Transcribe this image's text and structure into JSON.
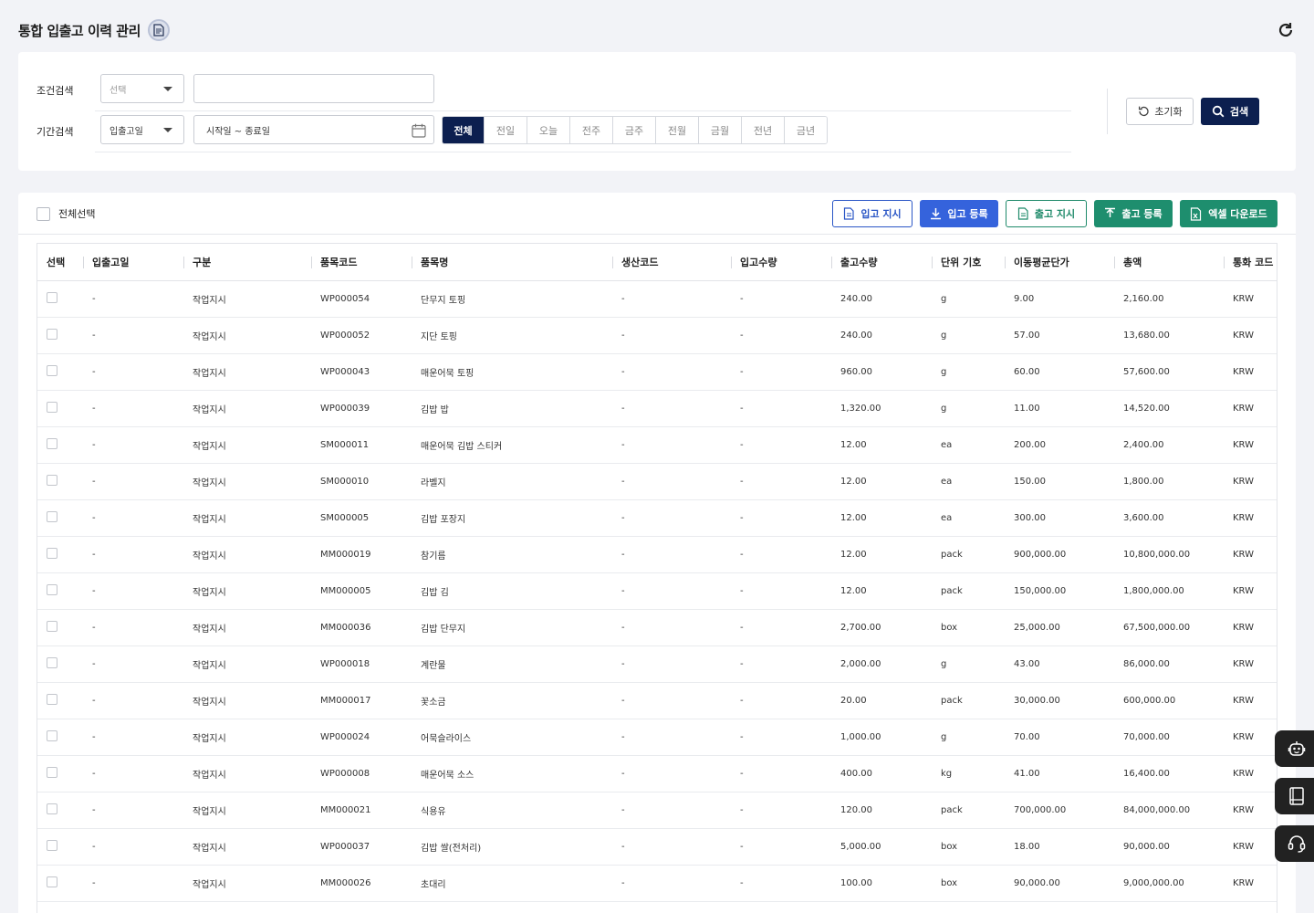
{
  "header": {
    "title": "통합 입출고 이력 관리"
  },
  "search": {
    "condition_label": "조건검색",
    "condition_select": "선택",
    "condition_input": "",
    "period_label": "기간검색",
    "period_select": "입출고일",
    "date_range": "시작일 ~ 종료일",
    "periods": [
      "전체",
      "전일",
      "오늘",
      "전주",
      "금주",
      "전월",
      "금월",
      "전년",
      "금년"
    ],
    "active_period": "전체",
    "reset_label": "초기화",
    "search_label": "검색"
  },
  "toolbar": {
    "select_all": "전체선택",
    "btn_in_order": "입고 지시",
    "btn_in_register": "입고 등록",
    "btn_out_order": "출고 지시",
    "btn_out_register": "출고 등록",
    "btn_excel": "엑셀 다운로드"
  },
  "table": {
    "columns": [
      "선택",
      "입출고일",
      "구분",
      "품목코드",
      "품목명",
      "생산코드",
      "입고수량",
      "출고수량",
      "단위 기호",
      "이동평균단가",
      "총액",
      "통화 코드"
    ],
    "rows": [
      [
        "-",
        "작업지시",
        "WP000054",
        "단무지 토핑",
        "-",
        "-",
        "240.00",
        "g",
        "9.00",
        "2,160.00",
        "KRW"
      ],
      [
        "-",
        "작업지시",
        "WP000052",
        "지단 토핑",
        "-",
        "-",
        "240.00",
        "g",
        "57.00",
        "13,680.00",
        "KRW"
      ],
      [
        "-",
        "작업지시",
        "WP000043",
        "매운어묵 토핑",
        "-",
        "-",
        "960.00",
        "g",
        "60.00",
        "57,600.00",
        "KRW"
      ],
      [
        "-",
        "작업지시",
        "WP000039",
        "김밥 밥",
        "-",
        "-",
        "1,320.00",
        "g",
        "11.00",
        "14,520.00",
        "KRW"
      ],
      [
        "-",
        "작업지시",
        "SM000011",
        "매운어묵 김밥 스티커",
        "-",
        "-",
        "12.00",
        "ea",
        "200.00",
        "2,400.00",
        "KRW"
      ],
      [
        "-",
        "작업지시",
        "SM000010",
        "라벨지",
        "-",
        "-",
        "12.00",
        "ea",
        "150.00",
        "1,800.00",
        "KRW"
      ],
      [
        "-",
        "작업지시",
        "SM000005",
        "김밥 포장지",
        "-",
        "-",
        "12.00",
        "ea",
        "300.00",
        "3,600.00",
        "KRW"
      ],
      [
        "-",
        "작업지시",
        "MM000019",
        "참기름",
        "-",
        "-",
        "12.00",
        "pack",
        "900,000.00",
        "10,800,000.00",
        "KRW"
      ],
      [
        "-",
        "작업지시",
        "MM000005",
        "김밥 김",
        "-",
        "-",
        "12.00",
        "pack",
        "150,000.00",
        "1,800,000.00",
        "KRW"
      ],
      [
        "-",
        "작업지시",
        "MM000036",
        "김밥 단무지",
        "-",
        "-",
        "2,700.00",
        "box",
        "25,000.00",
        "67,500,000.00",
        "KRW"
      ],
      [
        "-",
        "작업지시",
        "WP000018",
        "계란물",
        "-",
        "-",
        "2,000.00",
        "g",
        "43.00",
        "86,000.00",
        "KRW"
      ],
      [
        "-",
        "작업지시",
        "MM000017",
        "꽃소금",
        "-",
        "-",
        "20.00",
        "pack",
        "30,000.00",
        "600,000.00",
        "KRW"
      ],
      [
        "-",
        "작업지시",
        "WP000024",
        "어묵슬라이스",
        "-",
        "-",
        "1,000.00",
        "g",
        "70.00",
        "70,000.00",
        "KRW"
      ],
      [
        "-",
        "작업지시",
        "WP000008",
        "매운어묵 소스",
        "-",
        "-",
        "400.00",
        "kg",
        "41.00",
        "16,400.00",
        "KRW"
      ],
      [
        "-",
        "작업지시",
        "MM000021",
        "식용유",
        "-",
        "-",
        "120.00",
        "pack",
        "700,000.00",
        "84,000,000.00",
        "KRW"
      ],
      [
        "-",
        "작업지시",
        "WP000037",
        "김밥 쌀(전처리)",
        "-",
        "-",
        "5,000.00",
        "box",
        "18.00",
        "90,000.00",
        "KRW"
      ],
      [
        "-",
        "작업지시",
        "MM000026",
        "초대리",
        "-",
        "-",
        "100.00",
        "box",
        "90,000.00",
        "9,000,000.00",
        "KRW"
      ]
    ]
  },
  "floating": [
    "robot-icon",
    "book-icon",
    "headset-icon"
  ],
  "colors": {
    "primary": "#0c1f4f",
    "blue": "#3563dc",
    "green": "#1e8e6e"
  }
}
